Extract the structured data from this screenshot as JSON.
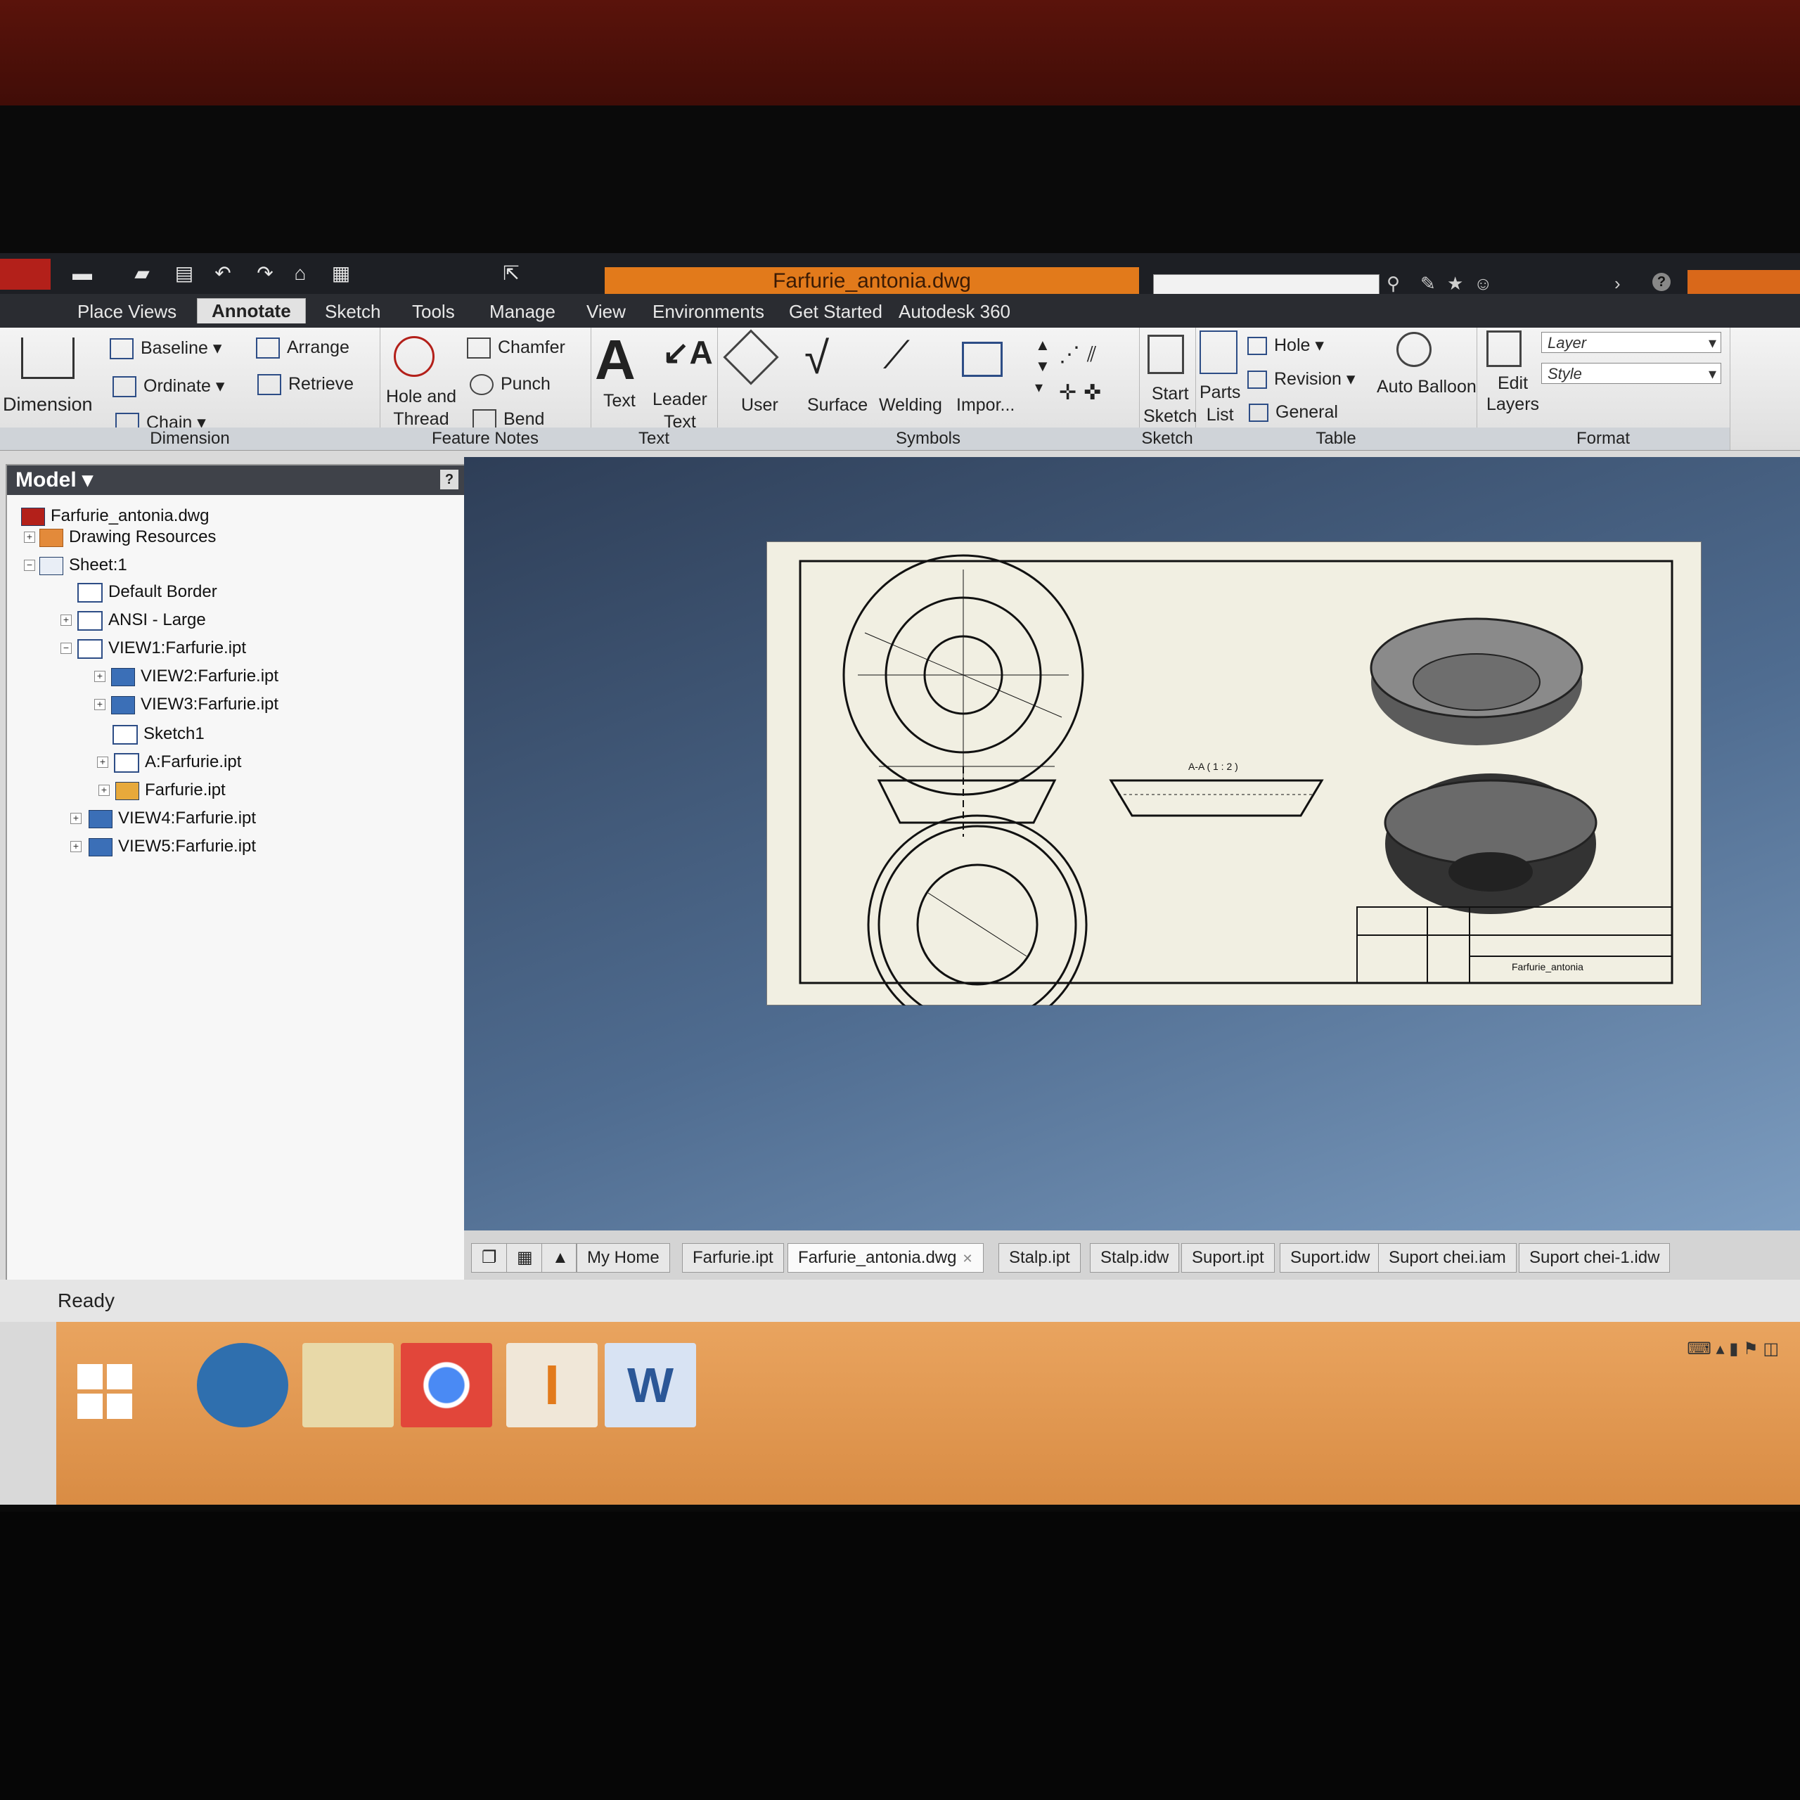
{
  "window": {
    "document_title": "Farfurie_antonia.dwg"
  },
  "menu_tabs": [
    {
      "label": "Place Views",
      "active": false
    },
    {
      "label": "Annotate",
      "active": true
    },
    {
      "label": "Sketch",
      "active": false
    },
    {
      "label": "Tools",
      "active": false
    },
    {
      "label": "Manage",
      "active": false
    },
    {
      "label": "View",
      "active": false
    },
    {
      "label": "Environments",
      "active": false
    },
    {
      "label": "Get Started",
      "active": false
    },
    {
      "label": "Autodesk 360",
      "active": false
    }
  ],
  "ribbon": {
    "dimension_panel": {
      "label": "Dimension",
      "dimension": "Dimension",
      "baseline": "Baseline",
      "ordinate": "Ordinate",
      "chain": "Chain",
      "arrange": "Arrange",
      "retrieve": "Retrieve"
    },
    "feature_notes_panel": {
      "label": "Feature Notes",
      "hole_and_thread_1": "Hole and",
      "hole_and_thread_2": "Thread",
      "chamfer": "Chamfer",
      "punch": "Punch",
      "bend": "Bend"
    },
    "text_panel": {
      "label": "Text",
      "text": "Text",
      "leader_text_1": "Leader",
      "leader_text_2": "Text"
    },
    "symbols_panel": {
      "label": "Symbols",
      "user": "User",
      "surface": "Surface",
      "welding": "Welding",
      "import": "Impor..."
    },
    "sketch_panel": {
      "label": "Sketch",
      "start_sketch_1": "Start",
      "start_sketch_2": "Sketch"
    },
    "table_panel": {
      "label": "Table",
      "parts_list_1": "Parts",
      "parts_list_2": "List",
      "hole": "Hole",
      "revision": "Revision",
      "general": "General",
      "auto_balloon": "Auto Balloon"
    },
    "format_panel": {
      "label": "Format",
      "edit_layers_1": "Edit",
      "edit_layers_2": "Layers",
      "layer": "Layer",
      "style": "Style"
    }
  },
  "browser": {
    "title": "Model",
    "items": [
      {
        "label": "Farfurie_antonia.dwg",
        "icon": "drawing-icon"
      },
      {
        "label": "Drawing Resources",
        "icon": "folder-icon"
      },
      {
        "label": "Sheet:1",
        "icon": "sheet-icon"
      },
      {
        "label": "Default Border",
        "icon": "border-icon"
      },
      {
        "label": "ANSI - Large",
        "icon": "titleblock-icon"
      },
      {
        "label": "VIEW1:Farfurie.ipt",
        "icon": "view-icon"
      },
      {
        "label": "VIEW2:Farfurie.ipt",
        "icon": "view-icon"
      },
      {
        "label": "VIEW3:Farfurie.ipt",
        "icon": "view-icon"
      },
      {
        "label": "Sketch1",
        "icon": "sketch-icon"
      },
      {
        "label": "A:Farfurie.ipt",
        "icon": "section-view-icon"
      },
      {
        "label": "Farfurie.ipt",
        "icon": "part-icon"
      },
      {
        "label": "VIEW4:Farfurie.ipt",
        "icon": "view-icon"
      },
      {
        "label": "VIEW5:Farfurie.ipt",
        "icon": "view-icon"
      }
    ]
  },
  "drawing": {
    "section_label": "A-A ( 1 : 2 )",
    "title_block_name": "Farfurie_antonia"
  },
  "document_tabs": [
    {
      "label": "My Home",
      "active": false
    },
    {
      "label": "Farfurie.ipt",
      "active": false
    },
    {
      "label": "Farfurie_antonia.dwg",
      "active": true
    },
    {
      "label": "Stalp.ipt",
      "active": false
    },
    {
      "label": "Stalp.idw",
      "active": false
    },
    {
      "label": "Suport.ipt",
      "active": false
    },
    {
      "label": "Suport.idw",
      "active": false
    },
    {
      "label": "Suport chei.iam",
      "active": false
    },
    {
      "label": "Suport chei-1.idw",
      "active": false
    }
  ],
  "status": {
    "text": "Ready"
  },
  "colors": {
    "accent": "#e27a1b",
    "titlebar": "#1d1f24",
    "taskbar": "#e09a52"
  }
}
